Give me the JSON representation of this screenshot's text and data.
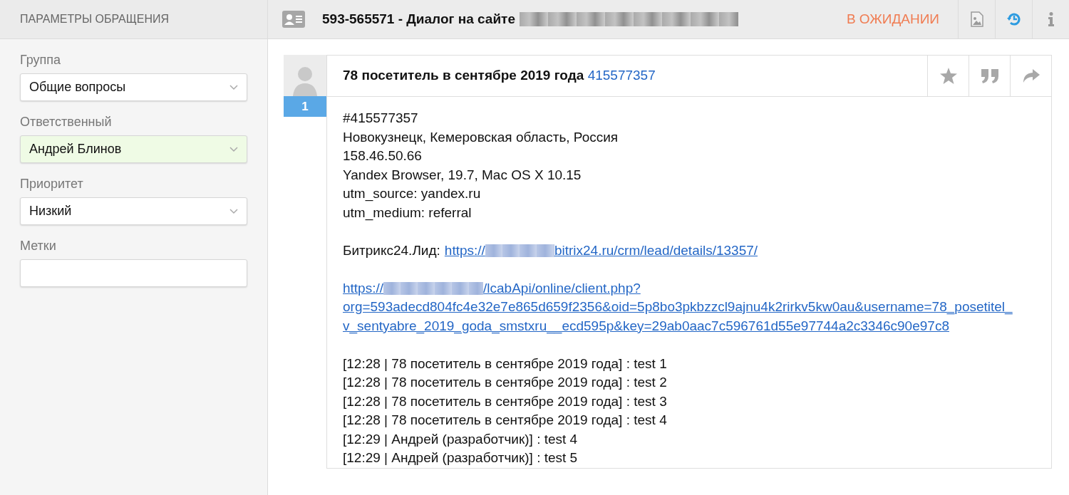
{
  "sidebar": {
    "title": "ПАРАМЕТРЫ ОБРАЩЕНИЯ",
    "fields": [
      {
        "label": "Группа",
        "kind": "select",
        "value": "Общие вопросы",
        "highlighted": false
      },
      {
        "label": "Ответственный",
        "kind": "select",
        "value": "Андрей Блинов",
        "highlighted": true
      },
      {
        "label": "Приоритет",
        "kind": "select",
        "value": "Низкий",
        "highlighted": false
      },
      {
        "label": "Метки",
        "kind": "text"
      }
    ]
  },
  "header": {
    "title": "593-565571 - Диалог на сайте",
    "redacted": true,
    "status": "В ОЖИДАНИИ"
  },
  "message": {
    "badge": "1",
    "author": "78 посетитель в сентябре 2019 года",
    "id_link": "415577357",
    "paragraphs": [
      {
        "kind": "lines",
        "lines": [
          "#415577357",
          "Новокузнецк, Кемеровская область, Россия",
          "158.46.50.66",
          "Yandex Browser, 19.7, Mac OS X 10.15",
          "utm_source: yandex.ru",
          "utm_medium: referral"
        ]
      },
      {
        "kind": "lead",
        "label": "Битрикс24.Лид:",
        "link": {
          "before": "https://",
          "redacted": true,
          "after": "bitrix24.ru/crm/lead/details/13357/"
        }
      },
      {
        "kind": "link",
        "link": {
          "before": "https://",
          "redacted": true,
          "after": "/lcabApi/online/client.php?",
          "query": "org=593adecd804fc4e32e7e865d659f2356&oid=5p8bo3pkbzzcl9ajnu4k2rirkv5kw0au&username=78_posetitel_v_sentyabre_2019_goda_smstxru__ecd595p&key=29ab0aac7c596761d55e97744a2c3346c90e97c8"
        }
      },
      {
        "kind": "lines",
        "lines": [
          "[12:28 | 78 посетитель в сентябре 2019 года] : test 1",
          "[12:28 | 78 посетитель в сентябре 2019 года] : test 2",
          "[12:28 | 78 посетитель в сентябре 2019 года] : test 3",
          "[12:28 | 78 посетитель в сентябре 2019 года] : test 4",
          "[12:29 | Андрей (разработчик)] : test 4",
          "[12:29 | Андрей (разработчик)] : test 5"
        ]
      }
    ]
  }
}
